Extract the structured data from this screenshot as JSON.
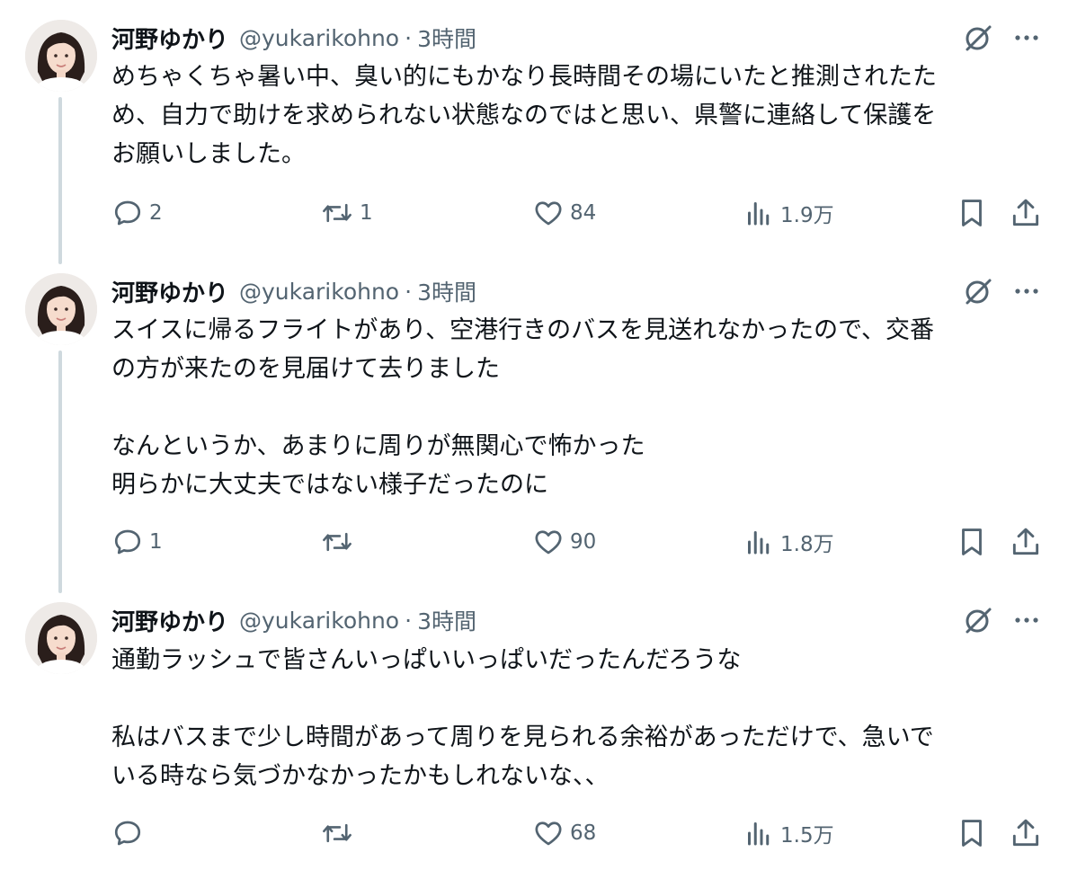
{
  "tweets": [
    {
      "author": {
        "name": "河野ゆかり",
        "handle": "@yukarikohno",
        "separator": "·",
        "time": "3時間"
      },
      "text": "めちゃくちゃ暑い中、臭い的にもかなり長時間その場にいたと推測されたた\nめ、自力で助けを求められない状態なのではと思い、県警に連絡して保護を\nお願いしました。",
      "replies": "2",
      "retweets": "1",
      "likes": "84",
      "views": "1.9万"
    },
    {
      "author": {
        "name": "河野ゆかり",
        "handle": "@yukarikohno",
        "separator": "·",
        "time": "3時間"
      },
      "text": "スイスに帰るフライトがあり、空港行きのバスを見送れなかったので、交番\nの方が来たのを見届けて去りました\n\nなんというか、あまりに周りが無関心で怖かった\n明らかに大丈夫ではない様子だったのに",
      "replies": "1",
      "retweets": "",
      "likes": "90",
      "views": "1.8万"
    },
    {
      "author": {
        "name": "河野ゆかり",
        "handle": "@yukarikohno",
        "separator": "·",
        "time": "3時間"
      },
      "text": "通勤ラッシュで皆さんいっぱいいっぱいだったんだろうな\n\n私はバスまで少し時間があって周りを見られる余裕があっただけで、急いで\nいる時なら気づかなかったかもしれないな、、",
      "replies": "",
      "retweets": "",
      "likes": "68",
      "views": "1.5万"
    }
  ],
  "icons": {
    "reply": "speech-bubble-icon",
    "retweet": "retweet-arrows-icon",
    "like": "heart-icon",
    "views": "bar-chart-icon",
    "bookmark": "bookmark-icon",
    "share": "share-upload-icon",
    "grok": "grok-slash-icon",
    "more": "ellipsis-icon"
  },
  "colors": {
    "text": "#0f1419",
    "secondary": "#536471",
    "thread_line": "#cfd9de",
    "background": "#ffffff"
  }
}
